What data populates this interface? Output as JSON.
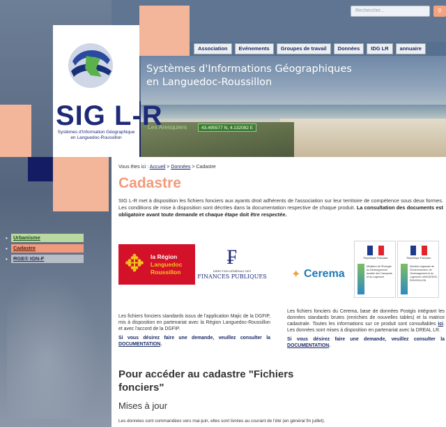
{
  "search": {
    "placeholder": "Rechercher...",
    "button_icon": "search-icon"
  },
  "nav": {
    "items": [
      "Association",
      "Evénements",
      "Groupes de travail",
      "Données",
      "IDG LR",
      "annuaire"
    ]
  },
  "logo": {
    "text": "SIG  L-R",
    "subtitle": "Systèmes d'Information Géographique en Languedoc-Roussillon"
  },
  "header": {
    "title": "Systèmes d'Informations Géographiques en Languedoc-Roussillon",
    "place": "Les Aresquiers",
    "coords": "43.495577 N, 4.132082 E"
  },
  "side_menu": {
    "items": [
      "Urbanisme",
      "Cadastre",
      "RGE® IGN-F"
    ]
  },
  "breadcrumb": {
    "prefix": "Vous êtes ici :",
    "home": "Accueil",
    "sep1": ">",
    "section": "Données",
    "sep2": ">",
    "current": "Cadastre"
  },
  "page": {
    "title": "Cadastre",
    "intro_plain": "SIG L-R met à disposition les fichiers fonciers aux ayants droit adhérents de l'association sur leur territoire de compétence sous deux formes. Les conditions de mise à disposition sont décrites dans la documentation respective de chaque produit.",
    "intro_bold": "La consultation des documents est obligatoire avant toute demande et chaque étape doit être respectée."
  },
  "partners": {
    "region_line1": "la Région",
    "region_line2": "Languedoc",
    "region_line3": "Roussillon",
    "dgfip_small": "DIRECTION GÉNÉRALE DES",
    "dgfip_main": "FINANCES PUBLIQUES",
    "cerema": "Cerema",
    "rf_label": "République Française",
    "rf1_desc": "Ministère de l'Écologie du Développement durable des Transports et du Logement",
    "rf2_desc": "Direction régionale de l'Environnement, de l'Aménagement et du Logement LANGUEDOC ROUSSILLON"
  },
  "columns": {
    "left_text": "Les fichiers fonciers standards issus de l'application Majic de la DGFIP, mis à disposition en partenariat avec la Région Languedoc-Roussillon et avec l'accord de la DGFIP.",
    "left_req": "Si vous désirez faire une demande, veuillez consulter la",
    "left_link": "DOCUMENTATION",
    "right_text_a": "Les fichiers fonciers du Cerema, base de données Postgis intégrant les données standards brutes (enrichies de nouvelles tables) et la matrice cadastrale. Toutes les informations sur ce produit sont consultables",
    "right_link_ici": "ici",
    "right_text_b": ". Les données sont mises à disposition en partenariat avec la DREAL LR.",
    "right_req": "Si vous désirez faire une demande, veuillez consulter la",
    "right_link": "DOCUMENTATION"
  },
  "section": {
    "title": "Pour accéder au cadastre \"Fichiers fonciers\"",
    "subtitle": "Mises à jour",
    "update_text": "Les données sont commandées vers mai-juin, elles sont livrées au courant de l'été (en général fin juillet)."
  }
}
